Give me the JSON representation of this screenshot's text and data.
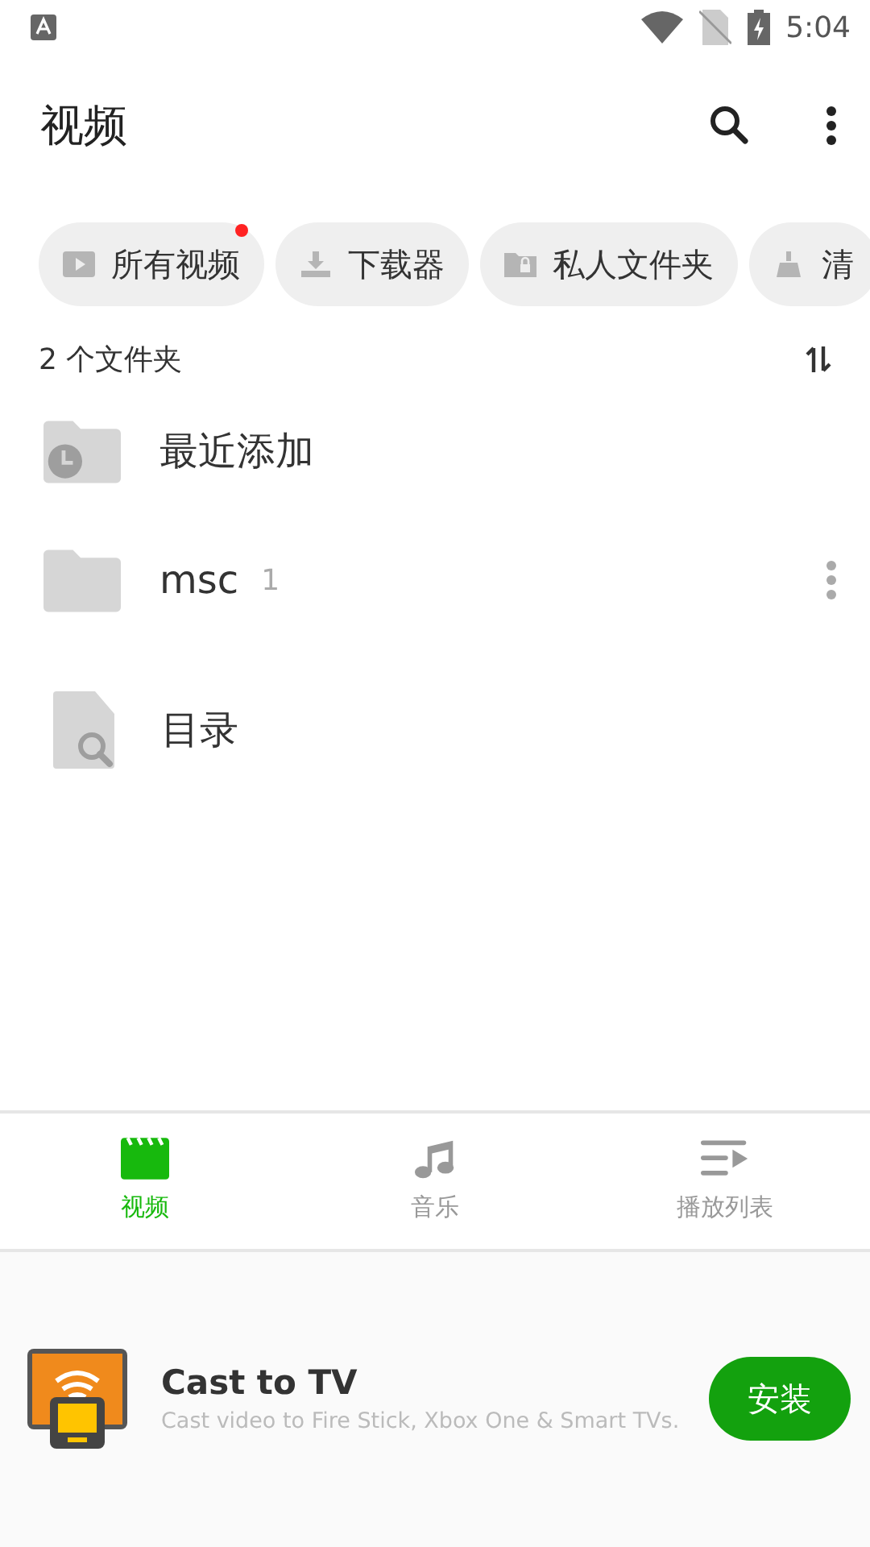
{
  "status_bar": {
    "time": "5:04"
  },
  "app_bar": {
    "title": "视频"
  },
  "chips": [
    {
      "kind": "video",
      "label": "所有视频",
      "badge": true
    },
    {
      "kind": "download",
      "label": "下载器",
      "badge": false
    },
    {
      "kind": "private",
      "label": "私人文件夹",
      "badge": false
    },
    {
      "kind": "clean",
      "label": "清",
      "badge": false
    }
  ],
  "folder_count": "2 个文件夹",
  "items": [
    {
      "kind": "recent",
      "name": "最近添加"
    },
    {
      "kind": "folder",
      "name": "msc",
      "count": "1"
    },
    {
      "kind": "catalog",
      "name": "目录"
    }
  ],
  "bottom_nav": [
    {
      "kind": "video",
      "label": "视频",
      "selected": true
    },
    {
      "kind": "music",
      "label": "音乐",
      "selected": false
    },
    {
      "kind": "playlist",
      "label": "播放列表",
      "selected": false
    }
  ],
  "ad": {
    "title": "Cast to TV",
    "subtitle": "Cast video to Fire Stick, Xbox One & Smart TVs.",
    "button": "安装"
  }
}
